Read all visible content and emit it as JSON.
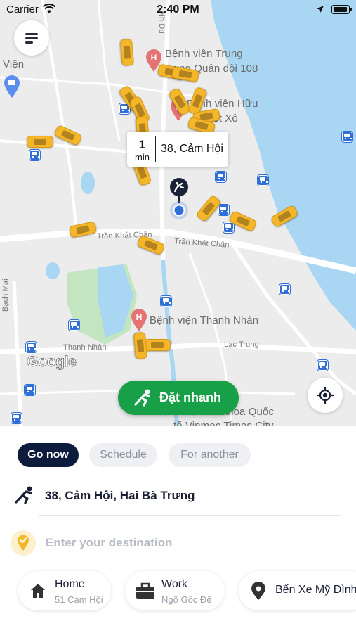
{
  "status_bar": {
    "carrier": "Carrier",
    "time": "2:40 PM"
  },
  "map": {
    "labels": {
      "hospital_108_line1": "Bệnh viện Trung",
      "hospital_108_line2": "ương Quân đội 108",
      "hospital_huu_nghi_line1": "Bệnh viện Hữu",
      "hospital_huu_nghi_line2": "Việt Xô",
      "vien": "Viện",
      "street_tran_khat_chan_1": "Trần Khát Chân",
      "street_tran_khat_chan_2": "Trần Khát Chân",
      "hospital_thanh_nhan": "Bệnh viện Thanh Nhàn",
      "thanh_nhan": "Thanh Nhàn",
      "lac_trung": "Lạc Trung",
      "bach_mai": "Bạch Mai",
      "hospital_vinmec_line1": "Bệnh viện Đa khoa Quốc",
      "hospital_vinmec_line2": "tế Vinmec Times City",
      "street_top": "Nh Du"
    },
    "attribution": "Google",
    "eta": {
      "minutes": "1",
      "unit": "min",
      "address": "38,  Cảm Hội"
    },
    "quick_book_label": "Đặt nhanh",
    "colors": {
      "water": "#a9d6f2",
      "park": "#c3e6c0",
      "taxi": "#f5b62a",
      "quick_book": "#18a048"
    }
  },
  "booking": {
    "tabs": [
      {
        "label": "Go now",
        "active": true
      },
      {
        "label": "Schedule",
        "active": false
      },
      {
        "label": "For another",
        "active": false
      }
    ],
    "pickup_address": "38, Cảm Hội, Hai Bà Trưng",
    "destination_placeholder": "Enter your destination",
    "favorites": [
      {
        "title": "Home",
        "subtitle": "51 Cảm Hội",
        "icon": "home-icon"
      },
      {
        "title": "Work",
        "subtitle": "Ngõ Gốc Đề",
        "icon": "briefcase-icon"
      },
      {
        "title": "Bến Xe Mỹ Đình",
        "subtitle": "",
        "icon": "place-pin-icon"
      }
    ],
    "colors": {
      "active_tab": "#0d1b3d",
      "inactive_tab": "#eef0f4",
      "destination_pin": "#f5b62a"
    }
  }
}
